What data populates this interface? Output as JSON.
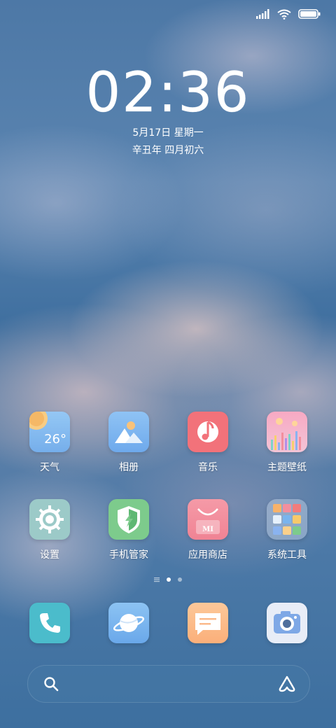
{
  "status_bar": {
    "signal_icon": "cellular-signal-icon",
    "wifi_icon": "wifi-icon",
    "battery_icon": "battery-icon",
    "battery_level": 1.0
  },
  "lockscreen": {
    "clock_hour": "02",
    "clock_separator": ":",
    "clock_minute": "36",
    "date": "5月17日 星期一",
    "lunar_date": "辛丑年 四月初六"
  },
  "apps_row1": [
    {
      "label": "天气",
      "icon": "weather-icon",
      "temperature": "26°"
    },
    {
      "label": "相册",
      "icon": "gallery-icon"
    },
    {
      "label": "音乐",
      "icon": "music-icon"
    },
    {
      "label": "主题壁纸",
      "icon": "themes-icon"
    }
  ],
  "apps_row2": [
    {
      "label": "设置",
      "icon": "settings-icon"
    },
    {
      "label": "手机管家",
      "icon": "security-icon"
    },
    {
      "label": "应用商店",
      "icon": "app-store-icon",
      "badge_text": "MI"
    },
    {
      "label": "系统工具",
      "icon": "folder-icon"
    }
  ],
  "page_indicator": {
    "pages": 3,
    "active": 1
  },
  "dock": [
    {
      "icon": "phone-icon"
    },
    {
      "icon": "browser-icon"
    },
    {
      "icon": "messages-icon"
    },
    {
      "icon": "camera-icon"
    }
  ],
  "search": {
    "search_icon": "search-icon",
    "assistant_icon": "assistant-icon"
  },
  "colors": {
    "weather": "#7fb6ee",
    "gallery": "#7ab4ee",
    "music": "#f2727a",
    "themes": "#f3a4c0",
    "settings": "#9ccac8",
    "security": "#7dcb8c",
    "app_store": "#f38f9e",
    "phone": "#4bbccb",
    "browser": "#79b7ef",
    "messages": "#fbb98b",
    "camera": "#e8edf7"
  }
}
